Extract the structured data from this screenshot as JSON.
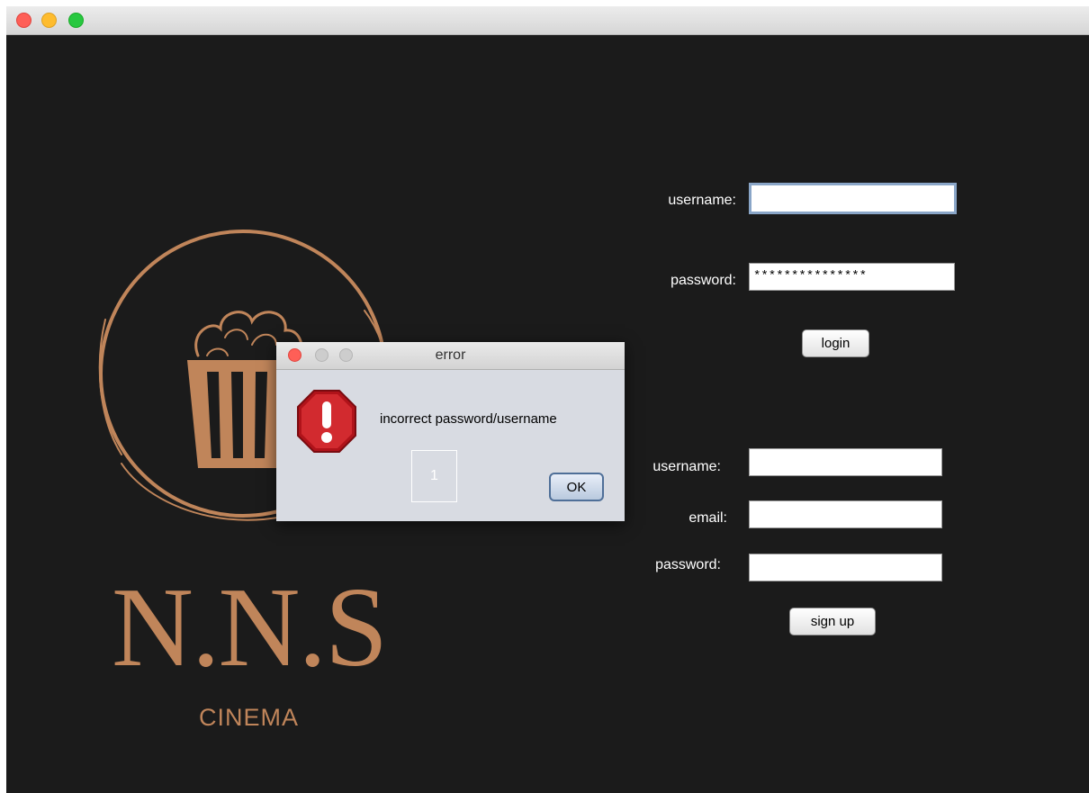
{
  "login": {
    "username_label": "username:",
    "username_value": "",
    "password_label": "password:",
    "password_value": "***************",
    "login_button": "login"
  },
  "signup": {
    "username_label": "username:",
    "username_value": "",
    "email_label": "email:",
    "email_value": "",
    "password_label": "password:",
    "password_value": "",
    "signup_button": "sign up"
  },
  "brand": {
    "name": "N.N.S",
    "sub": "CINEMA",
    "logo_icon": "popcorn-logo",
    "accent_color": "#c0855a"
  },
  "dialog": {
    "title": "error",
    "message": "incorrect password/username",
    "badge": "1",
    "ok_label": "OK",
    "icon": "error-stop-icon"
  },
  "colors": {
    "background": "#1b1b1b",
    "dialog_bg": "#d8dbe2"
  }
}
